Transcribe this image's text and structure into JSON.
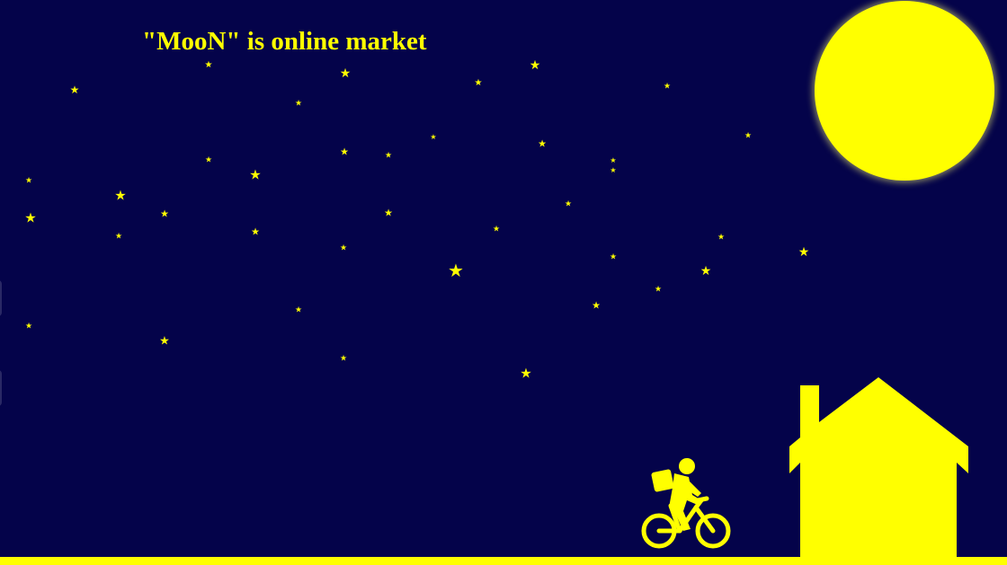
{
  "page": {
    "headline": "\"MooN\" is online market"
  },
  "colors": {
    "sky": "#04034a",
    "accent": "#ffff00"
  },
  "icons": {
    "moon": "moon-icon",
    "stars": "star-icon",
    "house": "house-icon",
    "cyclist": "delivery-cyclist-icon"
  }
}
